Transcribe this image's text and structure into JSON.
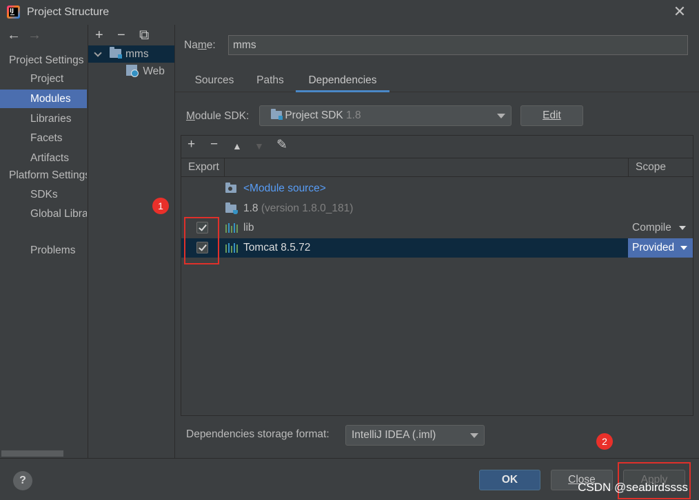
{
  "window": {
    "title": "Project Structure",
    "close_glyph": "✕"
  },
  "nav": {
    "back": "←",
    "forward": "→",
    "project_settings_header": "Project Settings",
    "project_settings_items": [
      "Project",
      "Modules",
      "Libraries",
      "Facets",
      "Artifacts"
    ],
    "platform_settings_header": "Platform Settings",
    "platform_settings_items": [
      "SDKs",
      "Global Libraries"
    ],
    "problems": "Problems"
  },
  "tree": {
    "add": "+",
    "remove": "−",
    "copy": "⧉",
    "module": "mms",
    "facet": "Web"
  },
  "module": {
    "name_label": "Name:",
    "name_value": "mms",
    "tabs": [
      "Sources",
      "Paths",
      "Dependencies"
    ],
    "sdk_label": "Module SDK:",
    "sdk_value": "Project SDK",
    "sdk_version": "1.8",
    "edit": "Edit"
  },
  "deps": {
    "toolbar": {
      "add": "+",
      "remove": "−",
      "up": "▲",
      "down": "▼",
      "edit": "✎"
    },
    "header": {
      "export": "Export",
      "scope": "Scope"
    },
    "rows": [
      {
        "name": "<Module source>"
      },
      {
        "name": "1.8",
        "detail": "(version 1.8.0_181)"
      },
      {
        "name": "lib",
        "scope": "Compile",
        "checked": true
      },
      {
        "name": "Tomcat 8.5.72",
        "scope": "Provided",
        "checked": true
      }
    ],
    "storage_label": "Dependencies storage format:",
    "storage_value": "IntelliJ IDEA (.iml)"
  },
  "footer": {
    "help": "?",
    "ok": "OK",
    "close": "Close",
    "apply": "Apply"
  },
  "annotations": {
    "badge1": "1",
    "badge2": "2"
  },
  "watermark": "CSDN @seabirdssss",
  "colors": {
    "selection": "#4b6eaf",
    "row_selection": "#0d293e",
    "link": "#589df6",
    "annotation_red": "#e0302a"
  }
}
